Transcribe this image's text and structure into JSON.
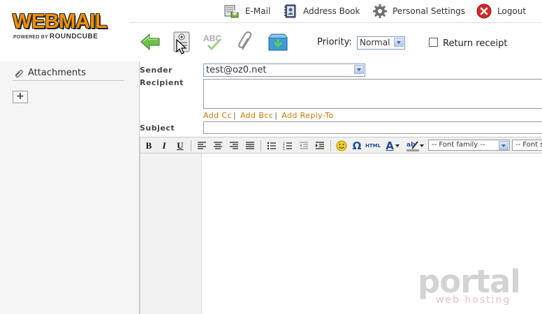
{
  "logo": {
    "word": "WEBMAIL",
    "powered_by": "POWERED BY",
    "product": "ROUNDCUBE"
  },
  "topnav": [
    {
      "label": "E-Mail",
      "icon": "envelope-icon"
    },
    {
      "label": "Address Book",
      "icon": "address-book-icon"
    },
    {
      "label": "Personal Settings",
      "icon": "gear-icon"
    },
    {
      "label": "Logout",
      "icon": "logout-icon"
    }
  ],
  "toolbar": {
    "buttons": [
      "back-arrow-icon",
      "send-icon",
      "spellcheck-icon",
      "paperclip-icon",
      "save-draft-icon"
    ],
    "priority_label": "Priority:",
    "priority_value": "Normal",
    "receipt_label": "Return receipt",
    "receipt_checked": false
  },
  "sidebar": {
    "attachments_title": "Attachments",
    "add_button": "+"
  },
  "form": {
    "sender_label": "Sender",
    "sender_value": "test@oz0.net",
    "recipient_label": "Recipient",
    "recipient_value": "",
    "add_cc": "Add Cc",
    "add_bcc": "Add Bcc",
    "add_reply_to": "Add Reply-To",
    "separator": "|",
    "subject_label": "Subject",
    "subject_value": ""
  },
  "editor": {
    "bold": "B",
    "italic": "I",
    "underline": "U",
    "omega": "Ω",
    "html": "HTML",
    "text_color": "A",
    "font_family": "-- Font family --",
    "font_size": "-- Font s"
  },
  "watermark": {
    "word": "portal",
    "sub": "web hosting"
  },
  "colors": {
    "accent": "#f29100",
    "link": "#cc7700",
    "sidebar_bg": "#f5f5f5"
  }
}
